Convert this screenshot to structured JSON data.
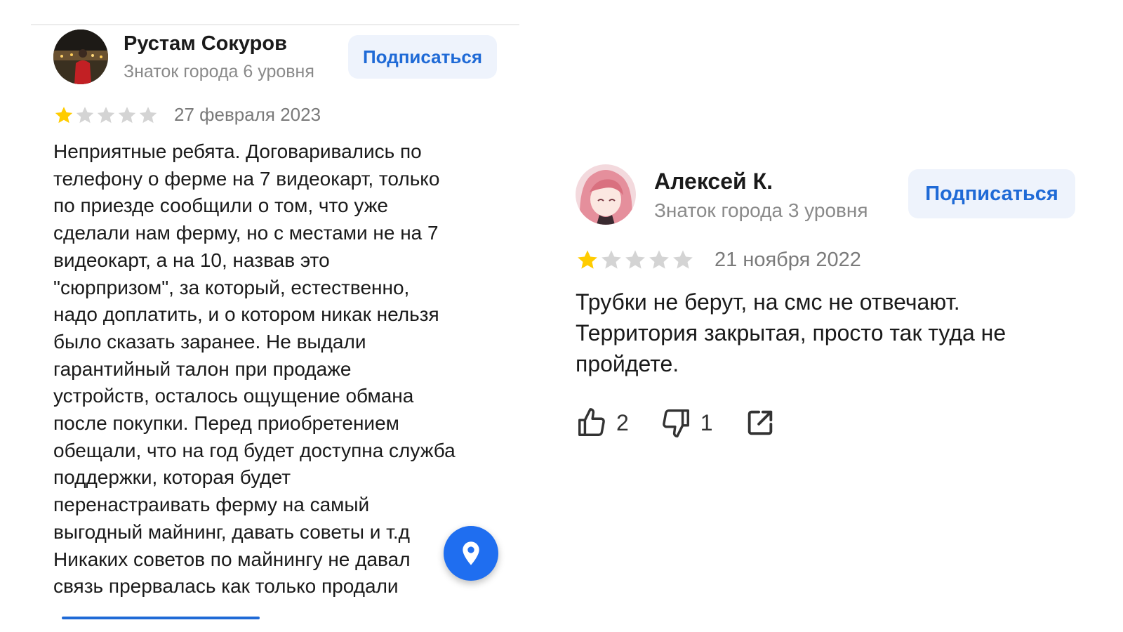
{
  "reviews": [
    {
      "author": "Рустам Сокуров",
      "level": "Знаток города 6 уровня",
      "subscribe_label": "Подписаться",
      "rating": 1,
      "date": "27 февраля 2023",
      "text_lines": [
        "Неприятные ребята. Договаривались по",
        "телефону о ферме на 7 видеокарт, только",
        "по приезде сообщили о том, что уже",
        "сделали нам ферму, но с местами не на 7",
        "видеокарт, а на 10, назвав это",
        "\"сюрпризом\", за который, естественно,",
        "надо доплатить, и о котором никак нельзя",
        "было сказать заранее. Не выдали",
        "гарантийный талон при продаже",
        "устройств, осталось ощущение обмана",
        "после покупки. Перед приобретением",
        "обещали, что на год будет доступна служба",
        "поддержки, которая будет",
        "перенастраивать ферму на самый",
        "выгодный майнинг, давать советы и т.д",
        "Никаких советов по майнингу не давал",
        "связь прервалась как только продали"
      ]
    },
    {
      "author": "Алексей К.",
      "level": "Знаток города 3 уровня",
      "subscribe_label": "Подписаться",
      "rating": 1,
      "date": "21 ноября 2022",
      "text_lines": [
        "Трубки не берут, на смс не отвечают.",
        "Территория закрытая, просто так туда не",
        "пройдете."
      ],
      "likes": "2",
      "dislikes": "1"
    }
  ],
  "icons": {
    "like": "thumbs-up-icon",
    "dislike": "thumbs-down-icon",
    "share": "share-icon",
    "fab": "map-pin-icon"
  },
  "colors": {
    "accent": "#1f6ad6",
    "subscribe_bg": "#eef3fc",
    "star_filled": "#ffcc00",
    "star_empty": "#d4d4d4",
    "fab_bg": "#1f6ef0"
  }
}
